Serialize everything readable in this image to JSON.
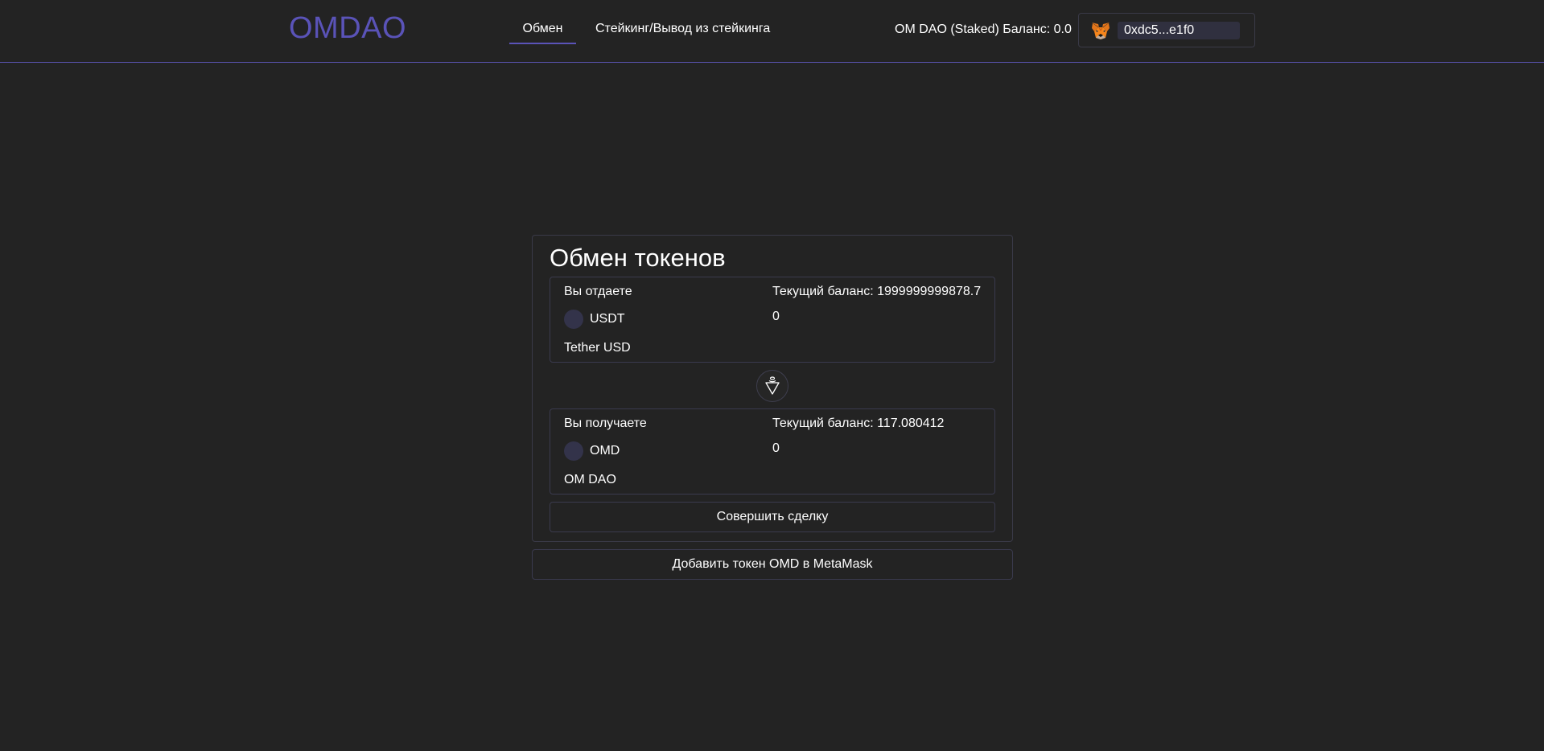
{
  "header": {
    "logo": "OMDAO",
    "tabs": [
      {
        "label": "Обмен",
        "active": true
      },
      {
        "label": "Стейкинг/Вывод из стейкинга",
        "active": false
      }
    ],
    "staked_balance": "OM DAO (Staked) Баланс: 0.0",
    "wallet": {
      "icon": "metamask-fox-icon",
      "address": "0xdc5...e1f0"
    }
  },
  "exchange": {
    "title": "Обмен токенов",
    "give": {
      "label": "Вы отдаете",
      "balance": "Текущий баланс: 1999999999878.7",
      "symbol": "USDT",
      "amount": "0",
      "name": "Tether USD"
    },
    "swap_icon": "swap-direction-icon",
    "get": {
      "label": "Вы получаете",
      "balance": "Текущий баланс: 117.080412",
      "symbol": "OMD",
      "amount": "0",
      "name": "OM DAO"
    },
    "submit_label": "Совершить сделку"
  },
  "add_token_label": "Добавить токен OMD в MetaMask",
  "colors": {
    "background": "#232323",
    "accent": "#5a53b8",
    "border": "#3a3a4e",
    "text": "#ffffff"
  }
}
